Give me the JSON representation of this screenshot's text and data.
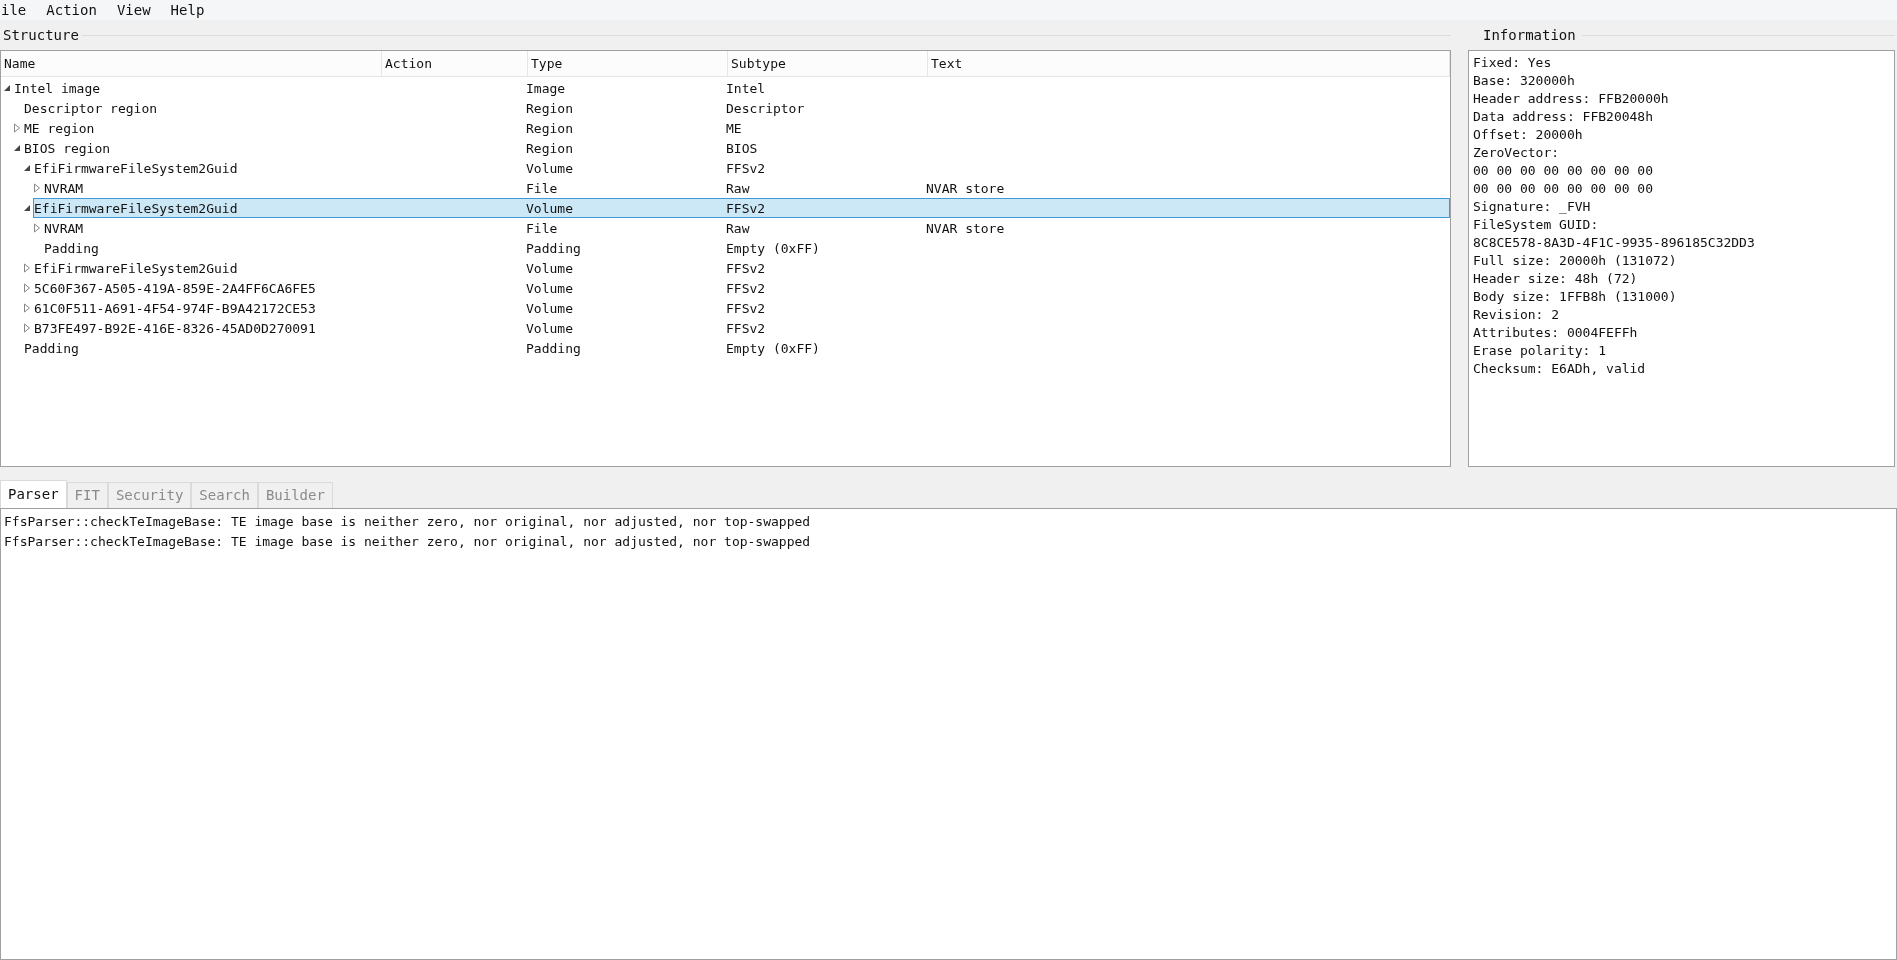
{
  "menu": [
    "ile",
    "Action",
    "View",
    "Help"
  ],
  "structure": {
    "title": "Structure",
    "columns": [
      "Name",
      "Action",
      "Type",
      "Subtype",
      "Text"
    ],
    "tree": [
      {
        "kind": "branch",
        "expanded": true,
        "selected": false,
        "name": "Intel image",
        "type": "Image",
        "subtype": "Intel",
        "children": [
          {
            "kind": "leaf",
            "selected": false,
            "name": "Descriptor region",
            "type": "Region",
            "subtype": "Descriptor"
          },
          {
            "kind": "branch",
            "expanded": false,
            "selected": false,
            "name": "ME region",
            "type": "Region",
            "subtype": "ME"
          },
          {
            "kind": "branch",
            "expanded": true,
            "selected": false,
            "name": "BIOS region",
            "type": "Region",
            "subtype": "BIOS",
            "children": [
              {
                "kind": "branch",
                "expanded": true,
                "selected": false,
                "name": "EfiFirmwareFileSystem2Guid",
                "type": "Volume",
                "subtype": "FFSv2",
                "children": [
                  {
                    "kind": "branch",
                    "expanded": false,
                    "selected": false,
                    "name": "NVRAM",
                    "type": "File",
                    "subtype": "Raw",
                    "text": "NVAR store"
                  }
                ]
              },
              {
                "kind": "branch",
                "expanded": true,
                "selected": true,
                "name": "EfiFirmwareFileSystem2Guid",
                "type": "Volume",
                "subtype": "FFSv2",
                "children": [
                  {
                    "kind": "branch",
                    "expanded": false,
                    "selected": false,
                    "name": "NVRAM",
                    "type": "File",
                    "subtype": "Raw",
                    "text": "NVAR store"
                  },
                  {
                    "kind": "leaf",
                    "selected": false,
                    "name": "Padding",
                    "type": "Padding",
                    "subtype": "Empty (0xFF)"
                  }
                ]
              },
              {
                "kind": "branch",
                "expanded": false,
                "selected": false,
                "name": "EfiFirmwareFileSystem2Guid",
                "type": "Volume",
                "subtype": "FFSv2"
              },
              {
                "kind": "branch",
                "expanded": false,
                "selected": false,
                "name": "5C60F367-A505-419A-859E-2A4FF6CA6FE5",
                "type": "Volume",
                "subtype": "FFSv2"
              },
              {
                "kind": "branch",
                "expanded": false,
                "selected": false,
                "name": "61C0F511-A691-4F54-974F-B9A42172CE53",
                "type": "Volume",
                "subtype": "FFSv2"
              },
              {
                "kind": "branch",
                "expanded": false,
                "selected": false,
                "name": "B73FE497-B92E-416E-8326-45AD0D270091",
                "type": "Volume",
                "subtype": "FFSv2"
              }
            ]
          },
          {
            "kind": "leaf",
            "selected": false,
            "name": "Padding",
            "type": "Padding",
            "subtype": "Empty (0xFF)"
          }
        ]
      }
    ]
  },
  "information": {
    "title": "Information",
    "lines": [
      "Fixed: Yes",
      "Base: 320000h",
      "Header address: FFB20000h",
      "Data address: FFB20048h",
      "Offset: 20000h",
      "ZeroVector:",
      "00 00 00 00 00 00 00 00",
      "00 00 00 00 00 00 00 00",
      "Signature: _FVH",
      "FileSystem GUID:",
      "8C8CE578-8A3D-4F1C-9935-896185C32DD3",
      "Full size: 20000h (131072)",
      "Header size: 48h (72)",
      "Body size: 1FFB8h (131000)",
      "Revision: 2",
      "Attributes: 0004FEFFh",
      "Erase polarity: 1",
      "Checksum: E6ADh, valid"
    ]
  },
  "tabs": [
    {
      "label": "Parser",
      "selected": true
    },
    {
      "label": "FIT",
      "selected": false
    },
    {
      "label": "Security",
      "selected": false
    },
    {
      "label": "Search",
      "selected": false
    },
    {
      "label": "Builder",
      "selected": false
    }
  ],
  "messages": [
    "FfsParser::checkTeImageBase: TE image base is neither zero, nor original, nor adjusted, nor top-swapped",
    "FfsParser::checkTeImageBase: TE image base is neither zero, nor original, nor adjusted, nor top-swapped"
  ]
}
